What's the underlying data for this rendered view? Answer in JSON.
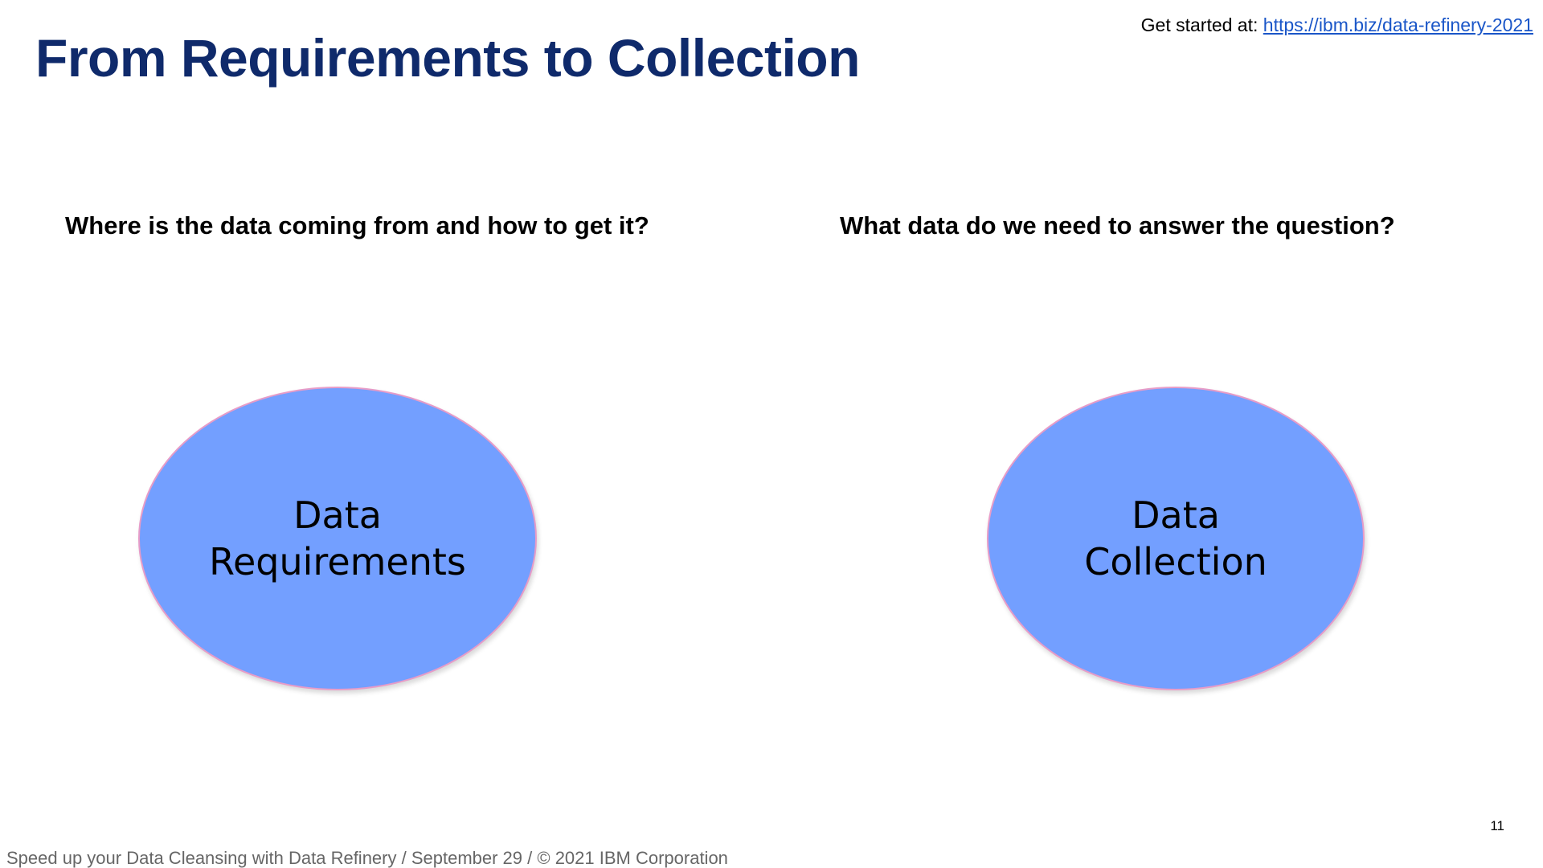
{
  "slide": {
    "title": "From Requirements to Collection",
    "get_started": {
      "label": "Get started at:",
      "link_text": "https://ibm.biz/data-refinery-2021"
    },
    "questions": {
      "left": "Where is the data coming from and how to get it?",
      "right": "What data do we need to answer the question?"
    },
    "ellipses": {
      "left": {
        "line1": "Data",
        "line2": "Requirements"
      },
      "right": {
        "line1": "Data",
        "line2": "Collection"
      }
    },
    "page_number": "11",
    "footer": "Speed up your Data Cleansing with Data Refinery / September 29 / © 2021 IBM Corporation",
    "colors": {
      "title": "#0f2a6b",
      "ellipse_fill": "#739fff",
      "ellipse_border": "#e79cc8",
      "link": "#1a56c8",
      "footer": "#666666"
    }
  }
}
